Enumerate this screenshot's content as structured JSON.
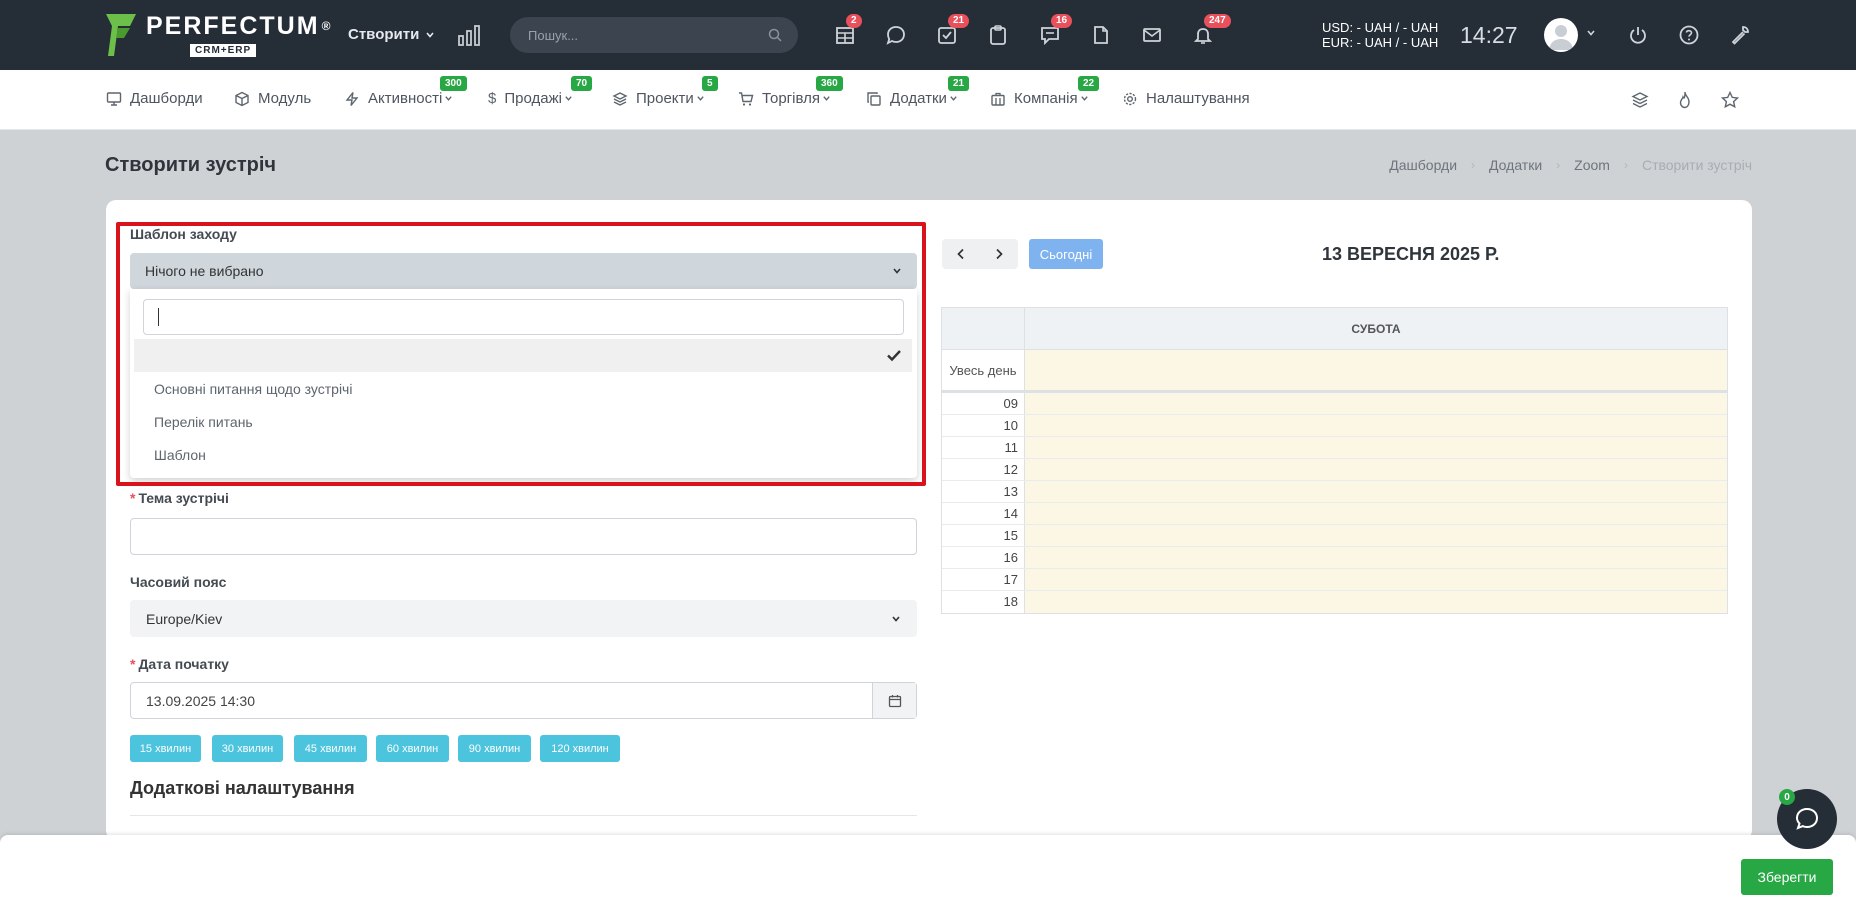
{
  "topbar": {
    "logo_name": "PERFECTUM",
    "logo_reg": "®",
    "logo_sub": "CRM+ERP",
    "create_label": "Створити",
    "search_placeholder": "Пошук...",
    "icons": [
      {
        "name": "calendar-grid-icon",
        "badge": "2"
      },
      {
        "name": "chat-icon",
        "badge": ""
      },
      {
        "name": "task-check-icon",
        "badge": "21"
      },
      {
        "name": "clipboard-icon",
        "badge": ""
      },
      {
        "name": "comments-icon",
        "badge": "16"
      },
      {
        "name": "document-icon",
        "badge": ""
      },
      {
        "name": "mail-icon",
        "badge": ""
      },
      {
        "name": "bell-icon",
        "badge": "247"
      }
    ],
    "currency_usd": "USD: - UAH / - UAH",
    "currency_eur": "EUR: - UAH / - UAH",
    "clock": "14:27"
  },
  "menu": {
    "items": [
      {
        "label": "Дашборди",
        "badge": "",
        "icon": "monitor-icon"
      },
      {
        "label": "Модуль",
        "badge": "",
        "icon": "cube-icon"
      },
      {
        "label": "Активності",
        "badge": "300",
        "icon": "bolt-icon"
      },
      {
        "label": "Продажі",
        "badge": "70",
        "icon": "dollar-icon"
      },
      {
        "label": "Проекти",
        "badge": "5",
        "icon": "layers-icon"
      },
      {
        "label": "Торгівля",
        "badge": "360",
        "icon": "cart-icon"
      },
      {
        "label": "Додатки",
        "badge": "21",
        "icon": "copy-icon"
      },
      {
        "label": "Компанія",
        "badge": "22",
        "icon": "building-icon"
      },
      {
        "label": "Налаштування",
        "badge": "",
        "icon": "gear-icon"
      }
    ]
  },
  "page": {
    "title": "Створити зустріч",
    "breadcrumb": [
      "Дашборди",
      "Додатки",
      "Zoom",
      "Створити зустріч"
    ]
  },
  "form": {
    "template_label": "Шаблон заходу",
    "template_value": "Нічого не вибрано",
    "template_options": [
      "Основні питання щодо зустрічі",
      "Перелік питань",
      "Шаблон"
    ],
    "topic_label": "Тема зустрічі",
    "topic_value": "",
    "timezone_label": "Часовий пояс",
    "timezone_value": "Europe/Kiev",
    "start_label": "Дата початку",
    "start_value": "13.09.2025 14:30",
    "quick_durations": [
      "15 хвилин",
      "30 хвилин",
      "45 хвилин",
      "60 хвилин",
      "90 хвилин",
      "120 хвилин"
    ],
    "extra_settings_title": "Додаткові налаштування"
  },
  "calendar": {
    "today_label": "Сьогодні",
    "title": "13 ВЕРЕСНЯ 2025 Р.",
    "day_header": "СУБОТА",
    "all_day_label": "Увесь день",
    "hours": [
      "09",
      "10",
      "11",
      "12",
      "13",
      "14",
      "15",
      "16",
      "17",
      "18"
    ]
  },
  "footer": {
    "save_label": "Зберегти",
    "chat_badge": "0"
  },
  "colors": {
    "topbar": "#252d37",
    "accent_green": "#28a745",
    "badge_red": "#e8505b",
    "highlight_red": "#d9131c",
    "quick_button": "#4cc4de",
    "today_button": "#7fb3f0"
  }
}
